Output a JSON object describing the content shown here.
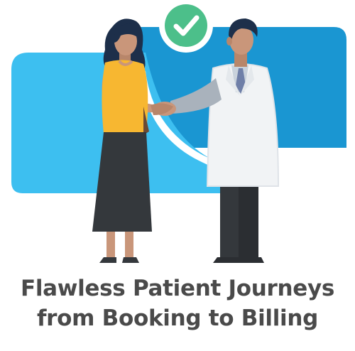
{
  "caption": {
    "line1": "Flawless Patient Journeys",
    "line2": "from Booking to Billing"
  },
  "icons": {
    "badge": "checkmark-icon"
  },
  "colors": {
    "blue_light": "#3dbff0",
    "blue_dark": "#1a96d2",
    "check_green": "#4cbf8a",
    "shirt_yellow": "#f7b731",
    "skirt_dark": "#34383c",
    "coat_white": "#f1f3f5",
    "text": "#4a4a4a"
  }
}
